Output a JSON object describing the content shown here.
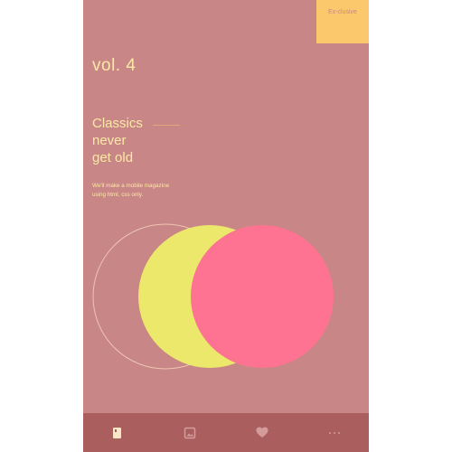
{
  "badge": {
    "label": "Ex-clusive"
  },
  "cover": {
    "volume": "vol. 4",
    "headline_lines": [
      "Classics",
      "never",
      "get old"
    ],
    "subtitle_lines": [
      "We'll make a mobile magazine",
      "using html, css only."
    ]
  },
  "colors": {
    "background": "#c88686",
    "badge": "#fbc96b",
    "text": "#fde9a6",
    "circle_yellow": "#ebe86b",
    "circle_pink": "#fd7391",
    "tabbar": "#ab5e5e"
  },
  "tabbar": {
    "items": [
      {
        "icon": "book-icon",
        "active": true
      },
      {
        "icon": "gallery-icon",
        "active": false
      },
      {
        "icon": "heart-icon",
        "active": false
      },
      {
        "icon": "more-icon",
        "active": false
      }
    ]
  }
}
